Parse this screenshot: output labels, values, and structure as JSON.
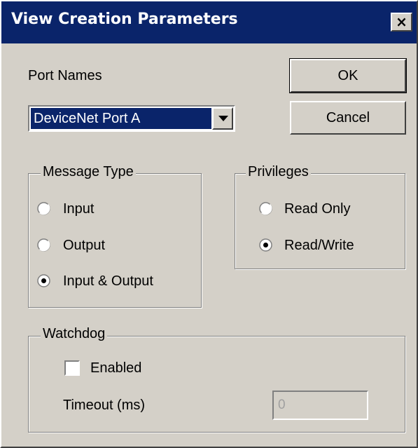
{
  "window": {
    "title": "View Creation Parameters",
    "close_label": "×"
  },
  "port_names": {
    "label": "Port Names",
    "selected": "DeviceNet Port A"
  },
  "buttons": {
    "ok_label": "OK",
    "cancel_label": "Cancel"
  },
  "message_type": {
    "title": "Message Type",
    "options": [
      {
        "label": "Input",
        "selected": false
      },
      {
        "label": "Output",
        "selected": false
      },
      {
        "label": "Input & Output",
        "selected": true
      }
    ]
  },
  "privileges": {
    "title": "Privileges",
    "options": [
      {
        "label": "Read Only",
        "selected": false
      },
      {
        "label": "Read/Write",
        "selected": true
      }
    ]
  },
  "watchdog": {
    "title": "Watchdog",
    "enabled_label": "Enabled",
    "enabled_checked": false,
    "timeout_label": "Timeout (ms)",
    "timeout_value": "0"
  },
  "colors": {
    "dialog_bg": "#d4d0c8",
    "title_bar": "#0a246a",
    "selection": "#0a246a"
  }
}
